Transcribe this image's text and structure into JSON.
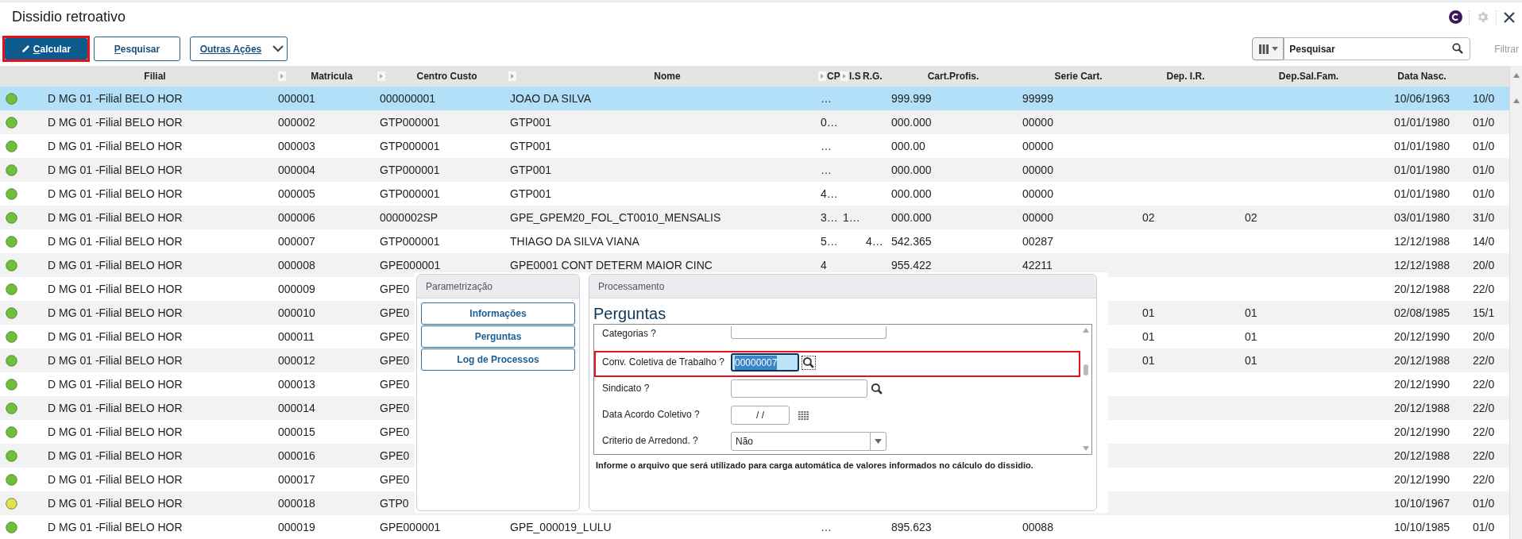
{
  "window": {
    "title": "Dissidio retroativo"
  },
  "toolbar": {
    "buttons": [
      {
        "label": "Calcular",
        "kind": "primary",
        "underlined_whole": false,
        "highlighted": true
      },
      {
        "label": "Pesquisar",
        "kind": "secondary",
        "underlined_whole": false,
        "highlighted": false
      },
      {
        "label": "Outras Ações",
        "kind": "menu",
        "underlined_whole": true,
        "highlighted": false
      }
    ],
    "search": {
      "placeholder": "Pesquisar"
    },
    "filter_label": "Filtrar"
  },
  "table": {
    "columns": [
      {
        "label": "Filial",
        "marker": false
      },
      {
        "label": "Matricula",
        "marker": true
      },
      {
        "label": "Centro Custo",
        "marker": true
      },
      {
        "label": "Nome",
        "marker": true
      },
      {
        "label": "CP",
        "marker": true
      },
      {
        "label": "I.S",
        "marker": true
      },
      {
        "label": "R.G.",
        "marker": false
      },
      {
        "label": "Cart.Profis.",
        "marker": false
      },
      {
        "label": "Serie Cart.",
        "marker": false
      },
      {
        "label": "Dep. I.R.",
        "marker": false
      },
      {
        "label": "Dep.Sal.Fam.",
        "marker": false
      },
      {
        "label": "Data Nasc.",
        "marker": false
      },
      {
        "marker": false
      }
    ],
    "rows": [
      {
        "color": "#6fbf3a",
        "selected": true,
        "filial": "D MG 01 -Filial BELO HOR",
        "matricula": "000001",
        "centro_custo": "000000001",
        "nome": "JOAO DA SILVA",
        "cpf": "…",
        "cart_profis": "999.999",
        "serie_cart": "99999",
        "data_nasc": "10/06/1963",
        "column_13": "10/0"
      },
      {
        "color": "#6fbf3a",
        "selected": false,
        "filial": "D MG 01 -Filial BELO HOR",
        "matricula": "000002",
        "centro_custo": "GTP000001",
        "nome": "GTP001",
        "cpf": "0…",
        "cart_profis": "000.000",
        "serie_cart": "00000",
        "data_nasc": "01/01/1980",
        "column_13": "01/0"
      },
      {
        "color": "#6fbf3a",
        "selected": false,
        "filial": "D MG 01 -Filial BELO HOR",
        "matricula": "000003",
        "centro_custo": "GTP000001",
        "nome": "GTP001",
        "cpf": "…",
        "cart_profis": "000.00",
        "serie_cart": "00000",
        "data_nasc": "01/01/1980",
        "column_13": "01/0"
      },
      {
        "color": "#6fbf3a",
        "selected": false,
        "filial": "D MG 01 -Filial BELO HOR",
        "matricula": "000004",
        "centro_custo": "GTP000001",
        "nome": "GTP001",
        "cpf": "…",
        "cart_profis": "000.000",
        "serie_cart": "00000",
        "data_nasc": "01/01/1980",
        "column_13": "01/0"
      },
      {
        "color": "#6fbf3a",
        "selected": false,
        "filial": "D MG 01 -Filial BELO HOR",
        "matricula": "000005",
        "centro_custo": "GTP000001",
        "nome": "GTP001",
        "cpf": "4…",
        "cart_profis": "000.000",
        "serie_cart": "00000",
        "data_nasc": "01/01/1980",
        "column_13": "01/0"
      },
      {
        "color": "#6fbf3a",
        "selected": false,
        "filial": "D MG 01 -Filial BELO HOR",
        "matricula": "000006",
        "centro_custo": "0000002SP",
        "nome": "GPE_GPEM20_FOL_CT0010_MENSALIS",
        "cpf": "3…",
        "pis": "1…",
        "cart_profis": "000.000",
        "serie_cart": "00000",
        "dep_ir": "02",
        "dep_sal_fam": "02",
        "data_nasc": "03/01/1980",
        "column_13": "31/0"
      },
      {
        "color": "#6fbf3a",
        "selected": false,
        "filial": "D MG 01 -Filial BELO HOR",
        "matricula": "000007",
        "centro_custo": "GTP000001",
        "nome": "THIAGO DA SILVA VIANA",
        "cpf": "5…",
        "rg": "4…",
        "cart_profis": "542.365",
        "serie_cart": "00287",
        "data_nasc": "12/12/1988",
        "column_13": "14/0"
      },
      {
        "color": "#6fbf3a",
        "selected": false,
        "filial": "D MG 01 -Filial BELO HOR",
        "matricula": "000008",
        "centro_custo": "GPE000001",
        "nome": "GPE0001 CONT DETERM MAIOR CINC",
        "cpf": "4",
        "cart_profis": "955.422",
        "serie_cart": "42211",
        "data_nasc": "12/12/1988",
        "column_13": "20/0"
      },
      {
        "color": "#6fbf3a",
        "selected": false,
        "filial": "D MG 01 -Filial BELO HOR",
        "matricula": "000009",
        "centro_custo": "GPE0",
        "data_nasc": "20/12/1988",
        "column_13": "22/0"
      },
      {
        "color": "#6fbf3a",
        "selected": false,
        "filial": "D MG 01 -Filial BELO HOR",
        "matricula": "000010",
        "centro_custo": "GPE0",
        "dep_ir": "01",
        "dep_sal_fam": "01",
        "data_nasc": "02/08/1985",
        "column_13": "15/1"
      },
      {
        "color": "#6fbf3a",
        "selected": false,
        "filial": "D MG 01 -Filial BELO HOR",
        "matricula": "000011",
        "centro_custo": "GPE0",
        "dep_ir": "01",
        "dep_sal_fam": "01",
        "data_nasc": "20/12/1990",
        "column_13": "20/0"
      },
      {
        "color": "#6fbf3a",
        "selected": false,
        "filial": "D MG 01 -Filial BELO HOR",
        "matricula": "000012",
        "centro_custo": "GPE0",
        "dep_ir": "01",
        "dep_sal_fam": "01",
        "data_nasc": "20/12/1988",
        "column_13": "22/0"
      },
      {
        "color": "#6fbf3a",
        "selected": false,
        "filial": "D MG 01 -Filial BELO HOR",
        "matricula": "000013",
        "centro_custo": "GPE0",
        "data_nasc": "20/12/1990",
        "column_13": "22/0"
      },
      {
        "color": "#6fbf3a",
        "selected": false,
        "filial": "D MG 01 -Filial BELO HOR",
        "matricula": "000014",
        "centro_custo": "GPE0",
        "data_nasc": "20/12/1988",
        "column_13": "22/0"
      },
      {
        "color": "#6fbf3a",
        "selected": false,
        "filial": "D MG 01 -Filial BELO HOR",
        "matricula": "000015",
        "centro_custo": "GPE0",
        "data_nasc": "20/12/1990",
        "column_13": "22/0"
      },
      {
        "color": "#6fbf3a",
        "selected": false,
        "filial": "D MG 01 -Filial BELO HOR",
        "matricula": "000016",
        "centro_custo": "GPE0",
        "data_nasc": "20/12/1988",
        "column_13": "22/0"
      },
      {
        "color": "#6fbf3a",
        "selected": false,
        "filial": "D MG 01 -Filial BELO HOR",
        "matricula": "000017",
        "centro_custo": "GPE0",
        "data_nasc": "20/12/1990",
        "column_13": "22/0"
      },
      {
        "color": "#e6df4f",
        "selected": false,
        "filial": "D MG 01 -Filial BELO HOR",
        "matricula": "000018",
        "centro_custo": "GTP0",
        "data_nasc": "10/10/1967",
        "column_13": "01/0"
      },
      {
        "color": "#6fbf3a",
        "selected": false,
        "filial": "D MG 01 -Filial BELO HOR",
        "matricula": "000019",
        "centro_custo": "GPE000001",
        "nome": "GPE_000019_LULU",
        "cpf": "…",
        "cart_profis": "895.623",
        "serie_cart": "00088",
        "data_nasc": "10/10/1985",
        "column_13": "01/0"
      }
    ]
  },
  "dialog": {
    "left_panel": {
      "title": "Parametrização",
      "buttons": [
        "Informações",
        "Perguntas",
        "Log de Processos"
      ]
    },
    "right_panel": {
      "title": "Processamento",
      "heading": "Perguntas",
      "questions": [
        {
          "kind": "text",
          "label": "Categorias ?",
          "cut": true,
          "highlighted": false,
          "focused": false,
          "lookup": false
        },
        {
          "kind": "text",
          "label": "Conv. Coletiva de Trabalho ?",
          "value": "00000007",
          "cut": false,
          "highlighted": true,
          "focused": true,
          "lookup": true
        },
        {
          "kind": "text",
          "label": "Sindicato ?",
          "cut": false,
          "highlighted": false,
          "focused": false,
          "lookup": true
        },
        {
          "kind": "date",
          "label": "Data Acordo Coletivo ?",
          "value": "/ /"
        },
        {
          "kind": "select",
          "label": "Criterio de Arredond. ?",
          "value": "Não"
        }
      ],
      "help": "Informe o arquivo que será utilizado para carga automática de valores informados no cálculo do dissidio."
    }
  }
}
